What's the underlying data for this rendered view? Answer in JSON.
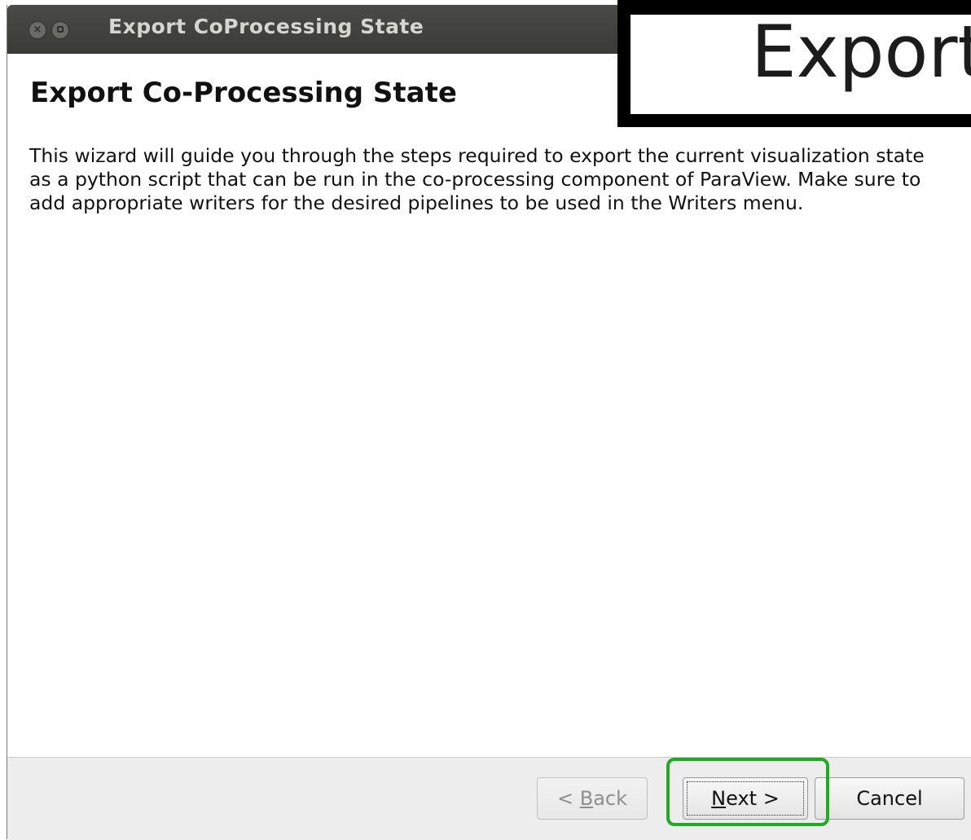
{
  "window": {
    "title": "Export CoProcessing State",
    "close_glyph": "×"
  },
  "page": {
    "heading": "Export Co-Processing State",
    "description": "This wizard will guide you through the steps required to export the current visualization state as a python script that can be run in the co-processing component of ParaView. Make sure to add appropriate writers for the desired pipelines to be used in the Writers menu."
  },
  "buttons": {
    "back_prefix": "< ",
    "back_mnemonic": "B",
    "back_rest": "ack",
    "next_mnemonic": "N",
    "next_rest": "ext >",
    "cancel": "Cancel"
  },
  "zoom_inset": {
    "text": "Export"
  },
  "colors": {
    "highlight": "#22aa22",
    "titlebar": "#3f3f3c"
  }
}
